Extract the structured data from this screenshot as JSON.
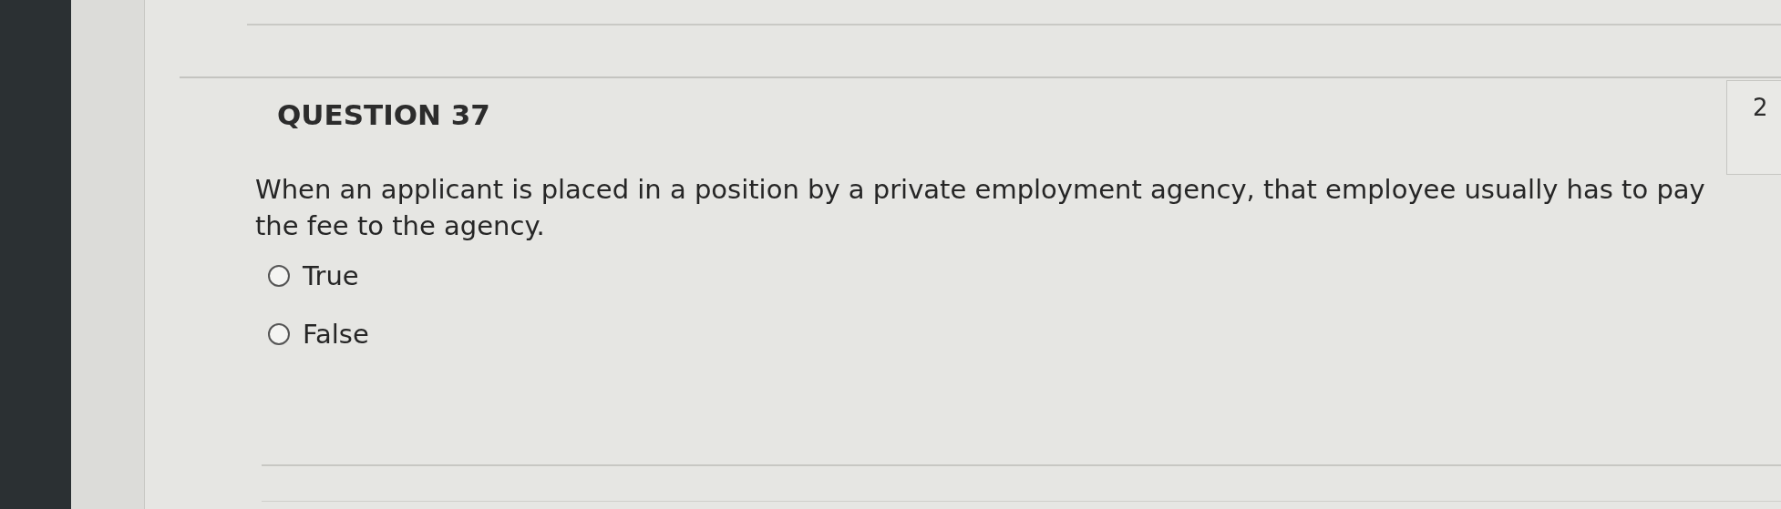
{
  "question": {
    "title": "QUESTION 37",
    "points": "2",
    "text": "When an applicant is placed in a position by a private employment agency, that employee usually has to pay the fee to the agency.",
    "options": [
      {
        "label": "True",
        "selected": false
      },
      {
        "label": "False",
        "selected": false
      }
    ]
  }
}
